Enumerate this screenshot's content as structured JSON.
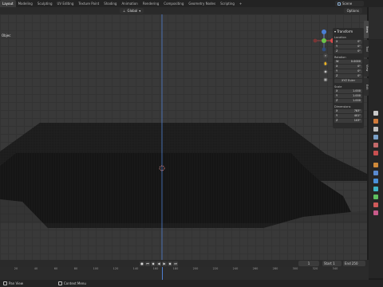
{
  "tabs": [
    "Layout",
    "Modeling",
    "Sculpting",
    "UV Editing",
    "Texture Paint",
    "Shading",
    "Animation",
    "Rendering",
    "Compositing",
    "Geometry Nodes",
    "Scripting",
    "+"
  ],
  "active_tab": 0,
  "scene": "Scene",
  "header": {
    "orientation": "Global",
    "options": "Options"
  },
  "viewport": {
    "label": "Objec"
  },
  "transform_panel": {
    "title": "Transform",
    "location_label": "Location",
    "location": [
      {
        "axis": "X",
        "value": "0\""
      },
      {
        "axis": "Y",
        "value": "0\""
      },
      {
        "axis": "Z",
        "value": "0\""
      }
    ],
    "rotation_label": "Rotation",
    "rotation": [
      {
        "axis": "W",
        "value": "0.0000"
      },
      {
        "axis": "X",
        "value": "0\""
      },
      {
        "axis": "Y",
        "value": "0\""
      },
      {
        "axis": "Z",
        "value": "0\""
      }
    ],
    "rotation_mode": "XYZ Euler",
    "scale_label": "Scale",
    "scale": [
      {
        "axis": "X",
        "value": "1.000"
      },
      {
        "axis": "Y",
        "value": "1.000"
      },
      {
        "axis": "Z",
        "value": "1.000"
      }
    ],
    "dimensions_label": "Dimensions",
    "dimensions": [
      {
        "axis": "X",
        "value": "783\""
      },
      {
        "axis": "Y",
        "value": "401\""
      },
      {
        "axis": "Z",
        "value": "103\""
      }
    ]
  },
  "side_tabs": [
    "Item",
    "Tool",
    "View",
    "Edit"
  ],
  "timeline": {
    "current_frame": "1",
    "start_label": "Start",
    "start": "1",
    "end_label": "End",
    "end": "250",
    "ruler": [
      "20",
      "40",
      "60",
      "80",
      "100",
      "120",
      "140",
      "160",
      "180",
      "200",
      "220",
      "240",
      "260",
      "280",
      "300",
      "320",
      "340"
    ]
  },
  "statusbar": {
    "left": "Pan View",
    "right": "Context Menu"
  }
}
